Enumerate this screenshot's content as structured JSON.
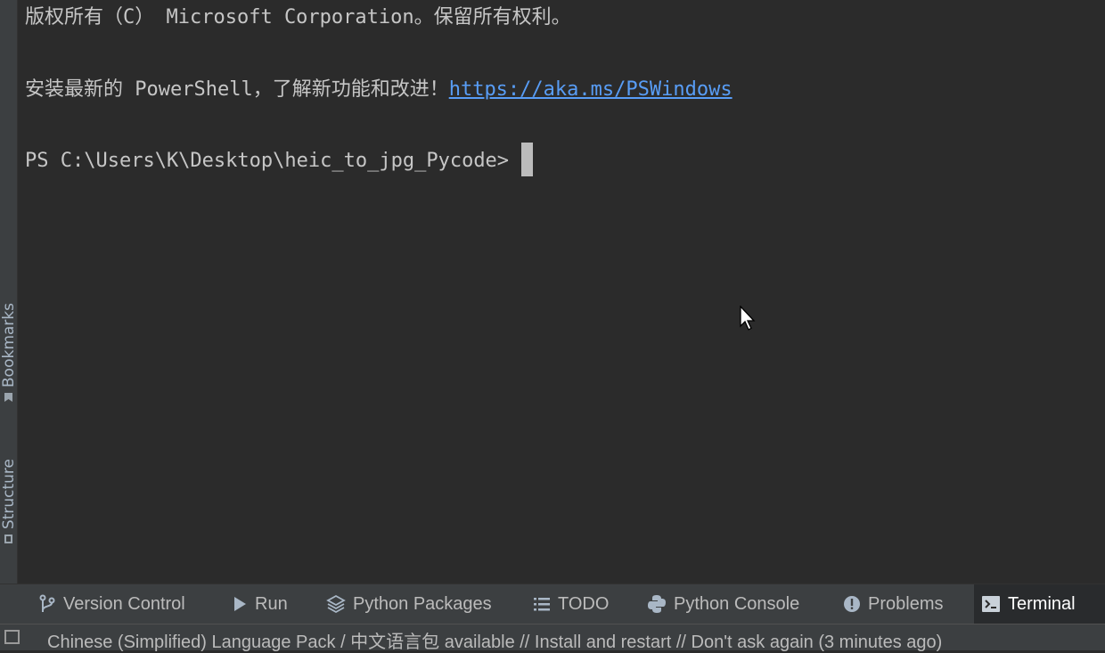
{
  "side_panel": {
    "bookmarks_label": "Bookmarks",
    "structure_label": "Structure"
  },
  "terminal": {
    "line1": "版权所有（C） Microsoft Corporation。保留所有权利。",
    "line2_text": "安装最新的 PowerShell，了解新功能和改进！",
    "line2_link": "https://aka.ms/PSWindows",
    "prompt": "PS C:\\Users\\K\\Desktop\\heic_to_jpg_Pycode>"
  },
  "toolbar": {
    "tabs": [
      {
        "label": "Version Control",
        "icon": "branch-icon"
      },
      {
        "label": "Run",
        "icon": "play-icon"
      },
      {
        "label": "Python Packages",
        "icon": "layers-icon"
      },
      {
        "label": "TODO",
        "icon": "list-icon"
      },
      {
        "label": "Python Console",
        "icon": "python-icon"
      },
      {
        "label": "Problems",
        "icon": "warning-icon"
      },
      {
        "label": "Terminal",
        "icon": "terminal-icon",
        "active": true
      }
    ]
  },
  "status": {
    "message": "Chinese (Simplified) Language Pack / 中文语言包 available // Install and restart // Don't ask again (3 minutes ago)"
  },
  "colors": {
    "background": "#2b2b2b",
    "panel": "#3c3f41",
    "link": "#589df6"
  }
}
